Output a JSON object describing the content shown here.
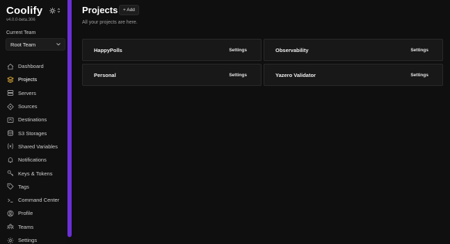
{
  "brand": {
    "title": "Coolify",
    "version": "v4.0.0-beta.306"
  },
  "team": {
    "label": "Current Team",
    "selected": "Root Team"
  },
  "nav": [
    {
      "label": "Dashboard",
      "icon": "home-icon",
      "active": false
    },
    {
      "label": "Projects",
      "icon": "layers-icon",
      "active": true
    },
    {
      "label": "Servers",
      "icon": "server-icon",
      "active": false
    },
    {
      "label": "Sources",
      "icon": "git-icon",
      "active": false
    },
    {
      "label": "Destinations",
      "icon": "destination-icon",
      "active": false
    },
    {
      "label": "S3 Storages",
      "icon": "database-icon",
      "active": false
    },
    {
      "label": "Shared Variables",
      "icon": "variable-icon",
      "active": false
    },
    {
      "label": "Notifications",
      "icon": "bell-icon",
      "active": false
    },
    {
      "label": "Keys & Tokens",
      "icon": "key-icon",
      "active": false
    },
    {
      "label": "Tags",
      "icon": "tag-icon",
      "active": false
    },
    {
      "label": "Command Center",
      "icon": "terminal-icon",
      "active": false
    },
    {
      "label": "Profile",
      "icon": "profile-icon",
      "active": false
    },
    {
      "label": "Teams",
      "icon": "teams-icon",
      "active": false
    },
    {
      "label": "Settings",
      "icon": "gear-icon",
      "active": false
    }
  ],
  "header": {
    "title": "Projects",
    "add_label": "+ Add",
    "subtitle": "All your projects are here."
  },
  "projects": [
    {
      "name": "HappyPolls",
      "settings_label": "Settings"
    },
    {
      "name": "Observability",
      "settings_label": "Settings"
    },
    {
      "name": "Personal",
      "settings_label": "Settings"
    },
    {
      "name": "Yazero Validator",
      "settings_label": "Settings"
    }
  ],
  "colors": {
    "accent": "#6b2fd6",
    "active_icon": "#f0b73a",
    "background": "#0f0f0f"
  }
}
